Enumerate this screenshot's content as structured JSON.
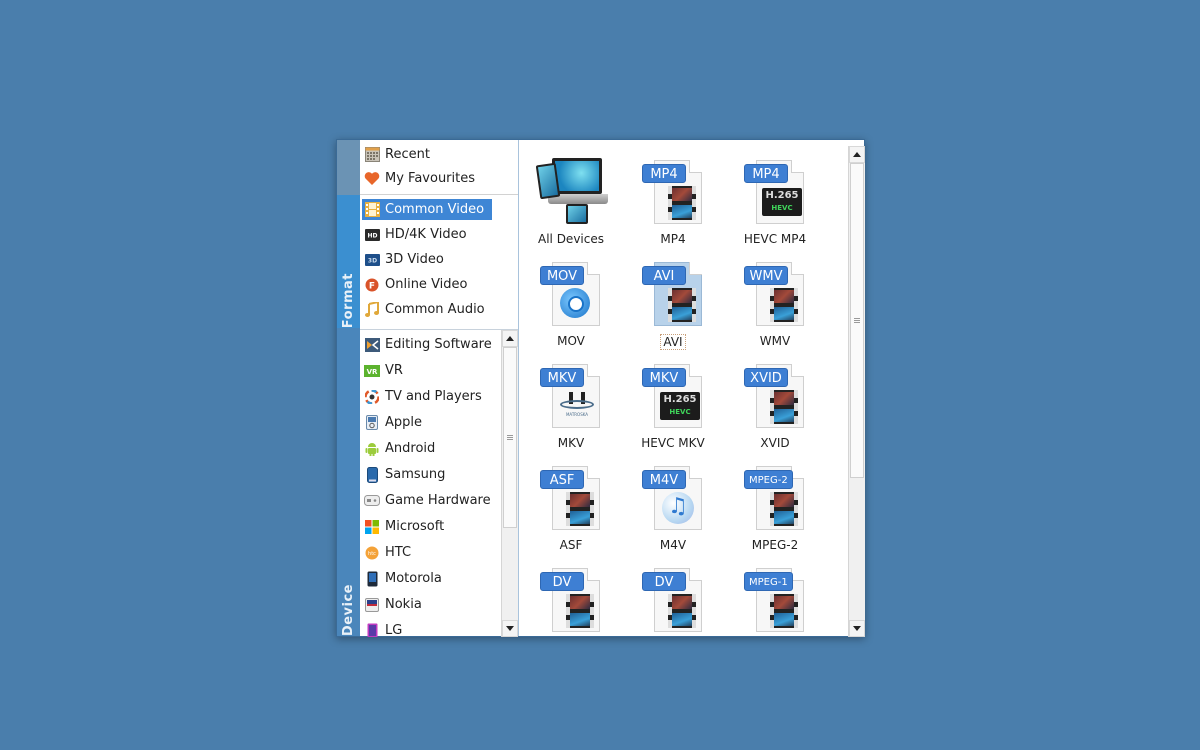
{
  "side_tabs": {
    "format": "Format",
    "device": "Device"
  },
  "quick_items": [
    {
      "label": "Recent",
      "icon": "calendar-icon"
    },
    {
      "label": "My Favourites",
      "icon": "heart-icon"
    }
  ],
  "format_items": [
    {
      "label": "Common Video",
      "icon": "film-icon",
      "selected": true
    },
    {
      "label": "HD/4K Video",
      "icon": "hd-icon"
    },
    {
      "label": "3D Video",
      "icon": "3d-icon"
    },
    {
      "label": "Online Video",
      "icon": "online-video-icon"
    },
    {
      "label": "Common Audio",
      "icon": "music-note-icon"
    }
  ],
  "device_items": [
    {
      "label": "Editing Software",
      "icon": "editing-software-icon"
    },
    {
      "label": "VR",
      "icon": "vr-icon"
    },
    {
      "label": "TV and Players",
      "icon": "tv-players-icon"
    },
    {
      "label": "Apple",
      "icon": "ipod-icon"
    },
    {
      "label": "Android",
      "icon": "android-icon"
    },
    {
      "label": "Samsung",
      "icon": "samsung-phone-icon"
    },
    {
      "label": "Game Hardware",
      "icon": "gamepad-icon"
    },
    {
      "label": "Microsoft",
      "icon": "microsoft-icon"
    },
    {
      "label": "HTC",
      "icon": "htc-icon"
    },
    {
      "label": "Motorola",
      "icon": "motorola-phone-icon"
    },
    {
      "label": "Nokia",
      "icon": "nokia-phone-icon"
    },
    {
      "label": "LG",
      "icon": "lg-phone-icon"
    }
  ],
  "formats": [
    {
      "label": "All Devices",
      "badge": "",
      "art": "devices"
    },
    {
      "label": "MP4",
      "badge": "MP4",
      "art": "film"
    },
    {
      "label": "HEVC MP4",
      "badge": "MP4",
      "art": "hevc",
      "hevc_top": "H.265",
      "hevc_bottom": "HEVC"
    },
    {
      "label": "MOV",
      "badge": "MOV",
      "art": "quicktime"
    },
    {
      "label": "AVI",
      "badge": "AVI",
      "art": "film",
      "selected": true
    },
    {
      "label": "WMV",
      "badge": "WMV",
      "art": "film"
    },
    {
      "label": "MKV",
      "badge": "MKV",
      "art": "matroska",
      "logo_text": "MATROSKA"
    },
    {
      "label": "HEVC MKV",
      "badge": "MKV",
      "art": "hevc",
      "hevc_top": "H.265",
      "hevc_bottom": "HEVC"
    },
    {
      "label": "XVID",
      "badge": "XVID",
      "art": "film"
    },
    {
      "label": "ASF",
      "badge": "ASF",
      "art": "film"
    },
    {
      "label": "M4V",
      "badge": "M4V",
      "art": "itunes"
    },
    {
      "label": "MPEG-2",
      "badge": "MPEG-2",
      "art": "film",
      "small": true
    },
    {
      "label": "",
      "badge": "DV",
      "art": "film"
    },
    {
      "label": "",
      "badge": "DV",
      "art": "film"
    },
    {
      "label": "",
      "badge": "MPEG-1",
      "art": "film",
      "small": true
    }
  ],
  "scroll": {
    "device_list_position": 0,
    "format_grid_position": 0
  }
}
